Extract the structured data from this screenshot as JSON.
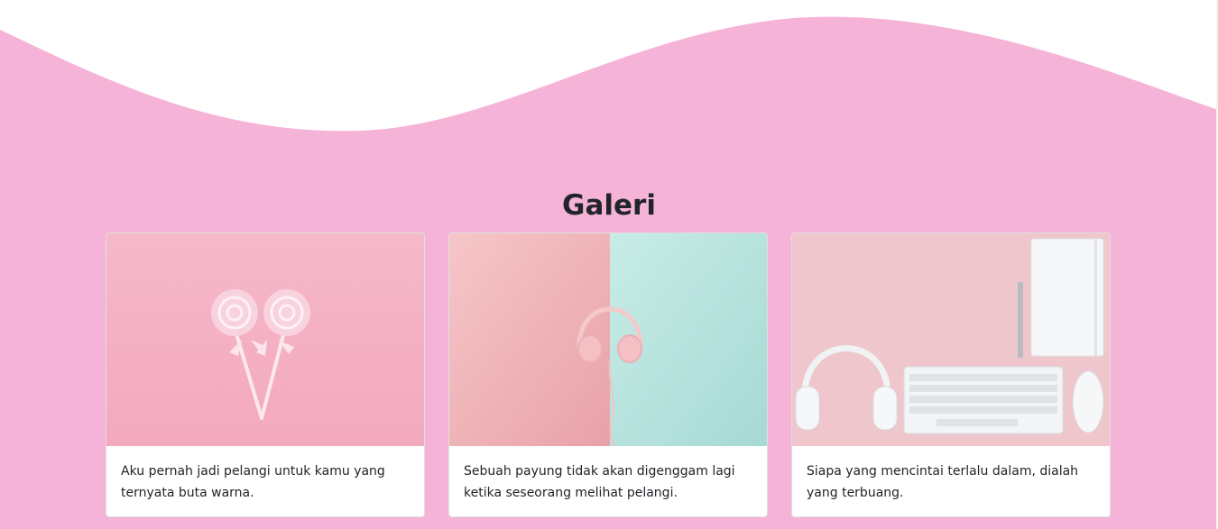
{
  "gallery": {
    "title": "Galeri",
    "cards": [
      {
        "image": "pink-lollipops-photo",
        "text": "Aku pernah jadi pelangi untuk kamu yang ternyata buta warna."
      },
      {
        "image": "headphones-pink-mint-photo",
        "text": "Sebuah payung tidak akan digenggam lagi ketika seseorang melihat pelangi."
      },
      {
        "image": "headphones-keyboard-notebook-photo",
        "text": "Siapa yang mencintai terlalu dalam, dialah yang terbuang."
      }
    ]
  },
  "colors": {
    "wave": "#f6b3d8",
    "background": "#ffffff"
  }
}
